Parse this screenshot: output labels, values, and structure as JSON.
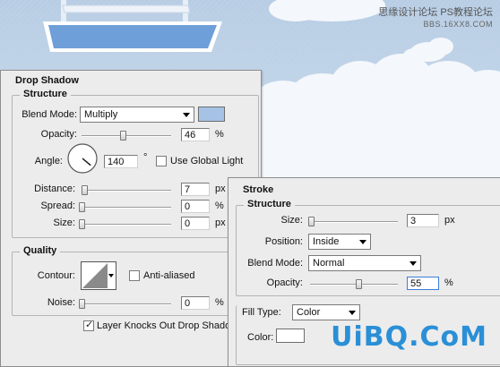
{
  "watermark": {
    "top_text": "思缘设计论坛",
    "top_site": "PS教程论坛",
    "top_url": "BBS.16XX8.COM",
    "bottom_text": "UiBQ.CoM"
  },
  "drop_shadow": {
    "title": "Drop Shadow",
    "structure": {
      "title": "Structure",
      "blend_mode_label": "Blend Mode:",
      "blend_mode_value": "Multiply",
      "swatch_color": "#a6c3e6",
      "opacity_label": "Opacity:",
      "opacity_value": "46",
      "opacity_level": 46,
      "percent": "%",
      "angle_label": "Angle:",
      "angle_value": "140",
      "degree": "°",
      "use_global_light_label": "Use Global Light",
      "use_global_light_checked": false,
      "distance_label": "Distance:",
      "distance_value": "7",
      "distance_level": 3,
      "spread_label": "Spread:",
      "spread_value": "0",
      "spread_level": 0,
      "size_label": "Size:",
      "size_value": "0",
      "size_level": 0,
      "px": "px"
    },
    "quality": {
      "title": "Quality",
      "contour_label": "Contour:",
      "anti_aliased_label": "Anti-aliased",
      "anti_aliased_checked": false,
      "noise_label": "Noise:",
      "noise_value": "0",
      "noise_level": 0
    },
    "layer_knocks_out_label": "Layer Knocks Out Drop Shadow",
    "layer_knocks_out_checked": true
  },
  "stroke": {
    "title": "Stroke",
    "structure": {
      "title": "Structure",
      "size_label": "Size:",
      "size_value": "3",
      "size_level": 1,
      "px": "px",
      "position_label": "Position:",
      "position_value": "Inside",
      "blend_mode_label": "Blend Mode:",
      "blend_mode_value": "Normal",
      "opacity_label": "Opacity:",
      "opacity_value": "55",
      "opacity_level": 55,
      "percent": "%"
    },
    "fill_type_label": "Fill Type:",
    "fill_type_value": "Color",
    "color_label": "Color:",
    "color_swatch": "#ffffff"
  }
}
